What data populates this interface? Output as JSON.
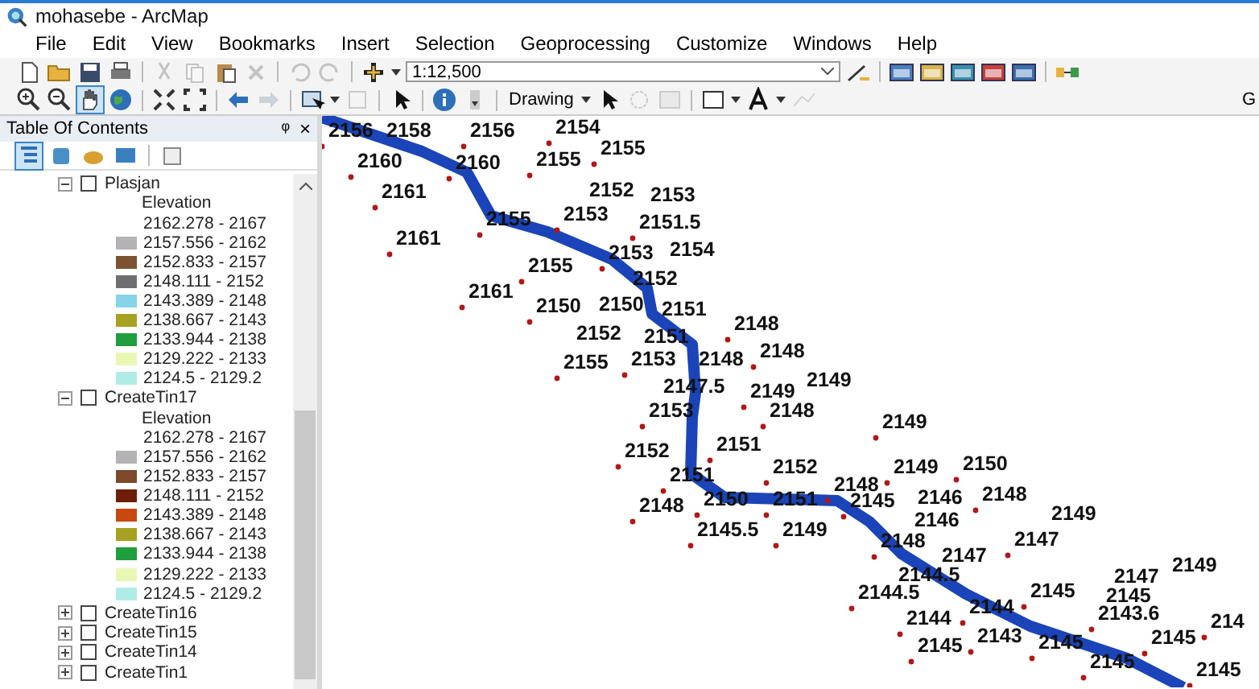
{
  "window": {
    "title": "mohasebe - ArcMap"
  },
  "menu": [
    "File",
    "Edit",
    "View",
    "Bookmarks",
    "Insert",
    "Selection",
    "Geoprocessing",
    "Customize",
    "Windows",
    "Help"
  ],
  "toolbar": {
    "scale": "1:12,500",
    "drawing": "Drawing",
    "cut_label": "G"
  },
  "toc": {
    "title": "Table Of Contents",
    "pin": "ᵠ",
    "close": "×",
    "layers": [
      {
        "name": "Plasjan",
        "expanded": true,
        "checked": false,
        "legend": {
          "heading": "Elevation",
          "classes": [
            {
              "label": "2162.278 - 2167"
            },
            {
              "label": "2157.556 - 2162",
              "color": "#b4b2b4"
            },
            {
              "label": "2152.833 - 2157",
              "color": "#7c5230"
            },
            {
              "label": "2148.111 - 2152",
              "color": "#6e6e72"
            },
            {
              "label": "2143.389 - 2148",
              "color": "#86d3ea"
            },
            {
              "label": "2138.667 - 2143",
              "color": "#a8a020"
            },
            {
              "label": "2133.944 - 2138",
              "color": "#1e9e3c"
            },
            {
              "label": "2129.222 - 2133",
              "color": "#e8f8b4"
            },
            {
              "label": "2124.5 - 2129.2",
              "color": "#b0ece6"
            }
          ]
        }
      },
      {
        "name": "CreateTin17",
        "expanded": true,
        "checked": false,
        "legend": {
          "heading": "Elevation",
          "classes": [
            {
              "label": "2162.278 - 2167"
            },
            {
              "label": "2157.556 - 2162",
              "color": "#b4b2b4"
            },
            {
              "label": "2152.833 - 2157",
              "color": "#7c4a2a"
            },
            {
              "label": "2148.111 - 2152",
              "color": "#6e1e08"
            },
            {
              "label": "2143.389 - 2148",
              "color": "#c84810"
            },
            {
              "label": "2138.667 - 2143",
              "color": "#a8a020"
            },
            {
              "label": "2133.944 - 2138",
              "color": "#1e9e3c"
            },
            {
              "label": "2129.222 - 2133",
              "color": "#e8f8b4"
            },
            {
              "label": "2124.5 - 2129.2",
              "color": "#b0ece6"
            }
          ]
        }
      },
      {
        "name": "CreateTin16",
        "expanded": false,
        "checked": false
      },
      {
        "name": "CreateTin15",
        "expanded": false,
        "checked": false
      },
      {
        "name": "CreateTin14",
        "expanded": false,
        "checked": false
      },
      {
        "name": "CreateTin1",
        "expanded": false,
        "checked": false
      }
    ]
  },
  "map": {
    "labels": [
      "2156",
      "2158",
      "2156",
      "2154",
      "2155",
      "2160",
      "2160",
      "2155",
      "2161",
      "2152",
      "2153",
      "2155",
      "2153",
      "2151.5",
      "2161",
      "2153",
      "2154",
      "2155",
      "2152",
      "2161",
      "2150",
      "2150",
      "2151",
      "2152",
      "2151",
      "2148",
      "2155",
      "2153",
      "2148",
      "2148",
      "2147.5",
      "2149",
      "2149",
      "2153",
      "2148",
      "2149",
      "2151",
      "2152",
      "2152",
      "2149",
      "2150",
      "2151",
      "2148",
      "2148",
      "2150",
      "2151",
      "2145",
      "2146",
      "2148",
      "2149",
      "2145.5",
      "2149",
      "2146",
      "2148",
      "2147",
      "2147",
      "2144.5",
      "2147",
      "2149",
      "2144.5",
      "2145",
      "2145",
      "2144",
      "2144",
      "2143.6",
      "214",
      "2145",
      "2143",
      "2145",
      "2145",
      "2145",
      "2145"
    ]
  }
}
